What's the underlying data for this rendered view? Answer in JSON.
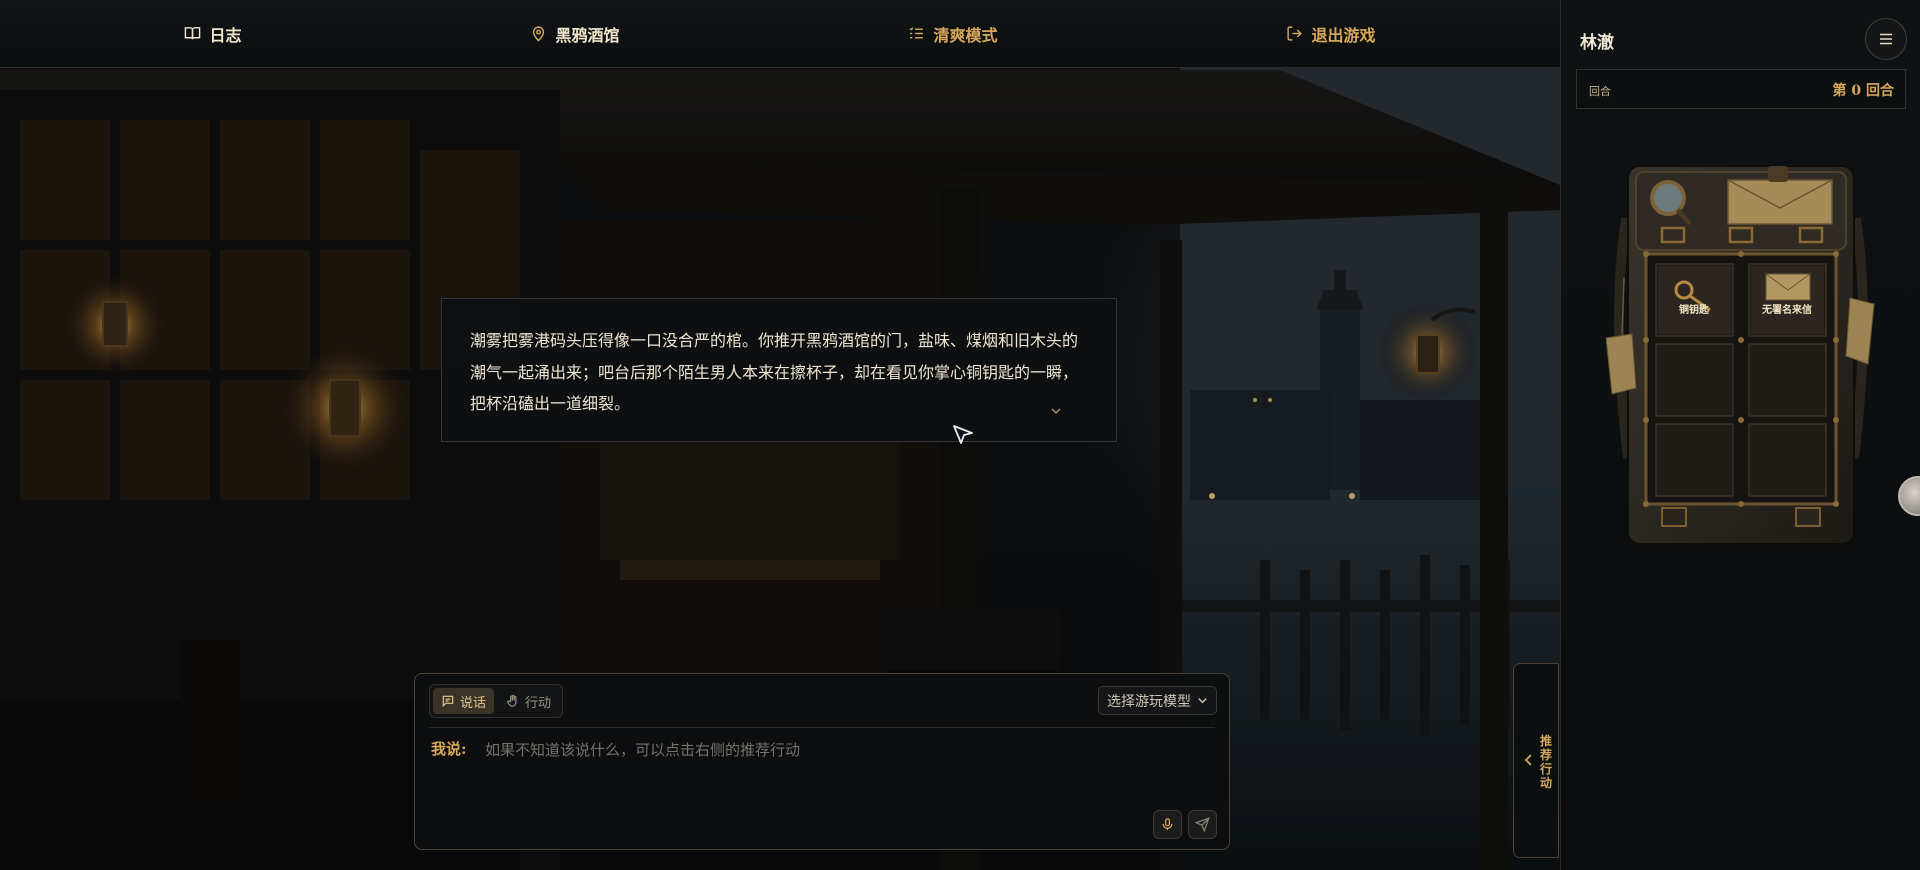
{
  "nav": {
    "journal_label": "日志",
    "location_label": "黑鸦酒馆",
    "mode_label": "清爽模式",
    "exit_label": "退出游戏"
  },
  "narration": {
    "text": "潮雾把雾港码头压得像一口没合严的棺。你推开黑鸦酒馆的门，盐味、煤烟和旧木头的潮气一起涌出来；吧台后那个陌生男人本来在擦杯子，却在看见你掌心铜钥匙的一瞬，把杯沿磕出一道细裂。"
  },
  "input_panel": {
    "speak_label": "说话",
    "act_label": "行动",
    "model_select_label": "选择游玩模型",
    "speaker_label": "我说:",
    "placeholder": "如果不知道该说什么，可以点击右侧的推荐行动"
  },
  "suggestions_tab": {
    "label": "推荐行动"
  },
  "side_panel": {
    "player_name": "林澈",
    "round_label": "回合",
    "round_value": "第 0 回合",
    "inventory": [
      {
        "label": "铜钥匙"
      },
      {
        "label": "无署名来信"
      }
    ]
  },
  "colors": {
    "accent_gold": "#d8a85a",
    "text_main": "#efe6d2",
    "panel_bg": "#0d0f10"
  },
  "icons": {
    "journal": "book-icon",
    "location": "map-pin-icon",
    "mode": "list-icon",
    "exit": "logout-icon",
    "speak": "message-icon",
    "act": "hand-icon",
    "mic": "microphone-icon",
    "send": "send-icon",
    "menu": "hamburger-icon"
  }
}
